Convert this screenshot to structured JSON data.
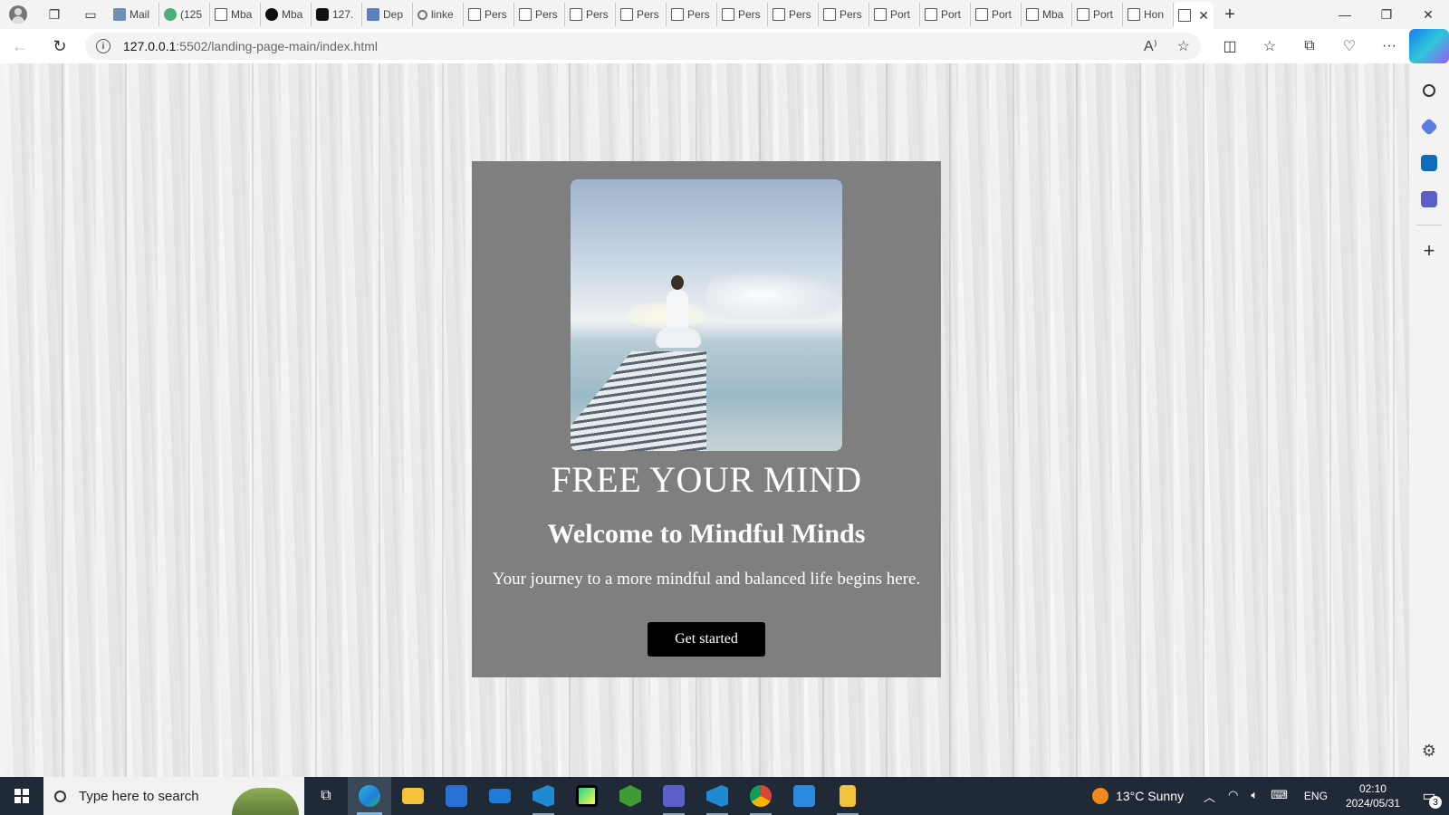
{
  "browser": {
    "tabs": [
      {
        "label": "Mail",
        "icon": "mail-icon"
      },
      {
        "label": "(125",
        "icon": "chat-icon"
      },
      {
        "label": "Mba",
        "icon": "page-icon"
      },
      {
        "label": "Mba",
        "icon": "github-icon"
      },
      {
        "label": "127.",
        "icon": "ms-icon"
      },
      {
        "label": "Dep",
        "icon": "word-icon"
      },
      {
        "label": "linke",
        "icon": "search-icon"
      },
      {
        "label": "Pers",
        "icon": "page-icon"
      },
      {
        "label": "Pers",
        "icon": "page-icon"
      },
      {
        "label": "Pers",
        "icon": "page-icon"
      },
      {
        "label": "Pers",
        "icon": "page-icon"
      },
      {
        "label": "Pers",
        "icon": "page-icon"
      },
      {
        "label": "Pers",
        "icon": "page-icon"
      },
      {
        "label": "Pers",
        "icon": "page-icon"
      },
      {
        "label": "Pers",
        "icon": "page-icon"
      },
      {
        "label": "Port",
        "icon": "page-icon"
      },
      {
        "label": "Port",
        "icon": "page-icon"
      },
      {
        "label": "Port",
        "icon": "page-icon"
      },
      {
        "label": "Mba",
        "icon": "page-icon"
      },
      {
        "label": "Port",
        "icon": "page-icon"
      },
      {
        "label": "Hon",
        "icon": "page-icon"
      }
    ],
    "active_tab_close": "✕",
    "new_tab": "+",
    "url_host": "127.0.0.1",
    "url_path": ":5502/landing-page-main/index.html"
  },
  "page": {
    "headline": "FREE YOUR MIND",
    "welcome": "Welcome to Mindful Minds",
    "subtext": "Your journey to a more mindful and balanced life begins here.",
    "cta_label": "Get started",
    "card_color": "#7f7f7f",
    "button_color": "#000000"
  },
  "taskbar": {
    "search_placeholder": "Type here to search",
    "weather": "13°C  Sunny",
    "language": "ENG",
    "time": "02:10",
    "date": "2024/05/31",
    "notification_count": "3"
  },
  "colors": {
    "taskbar_bg": "#1f2a36",
    "browser_chrome": "#f3f3f3",
    "accent": "#76b9ed"
  }
}
